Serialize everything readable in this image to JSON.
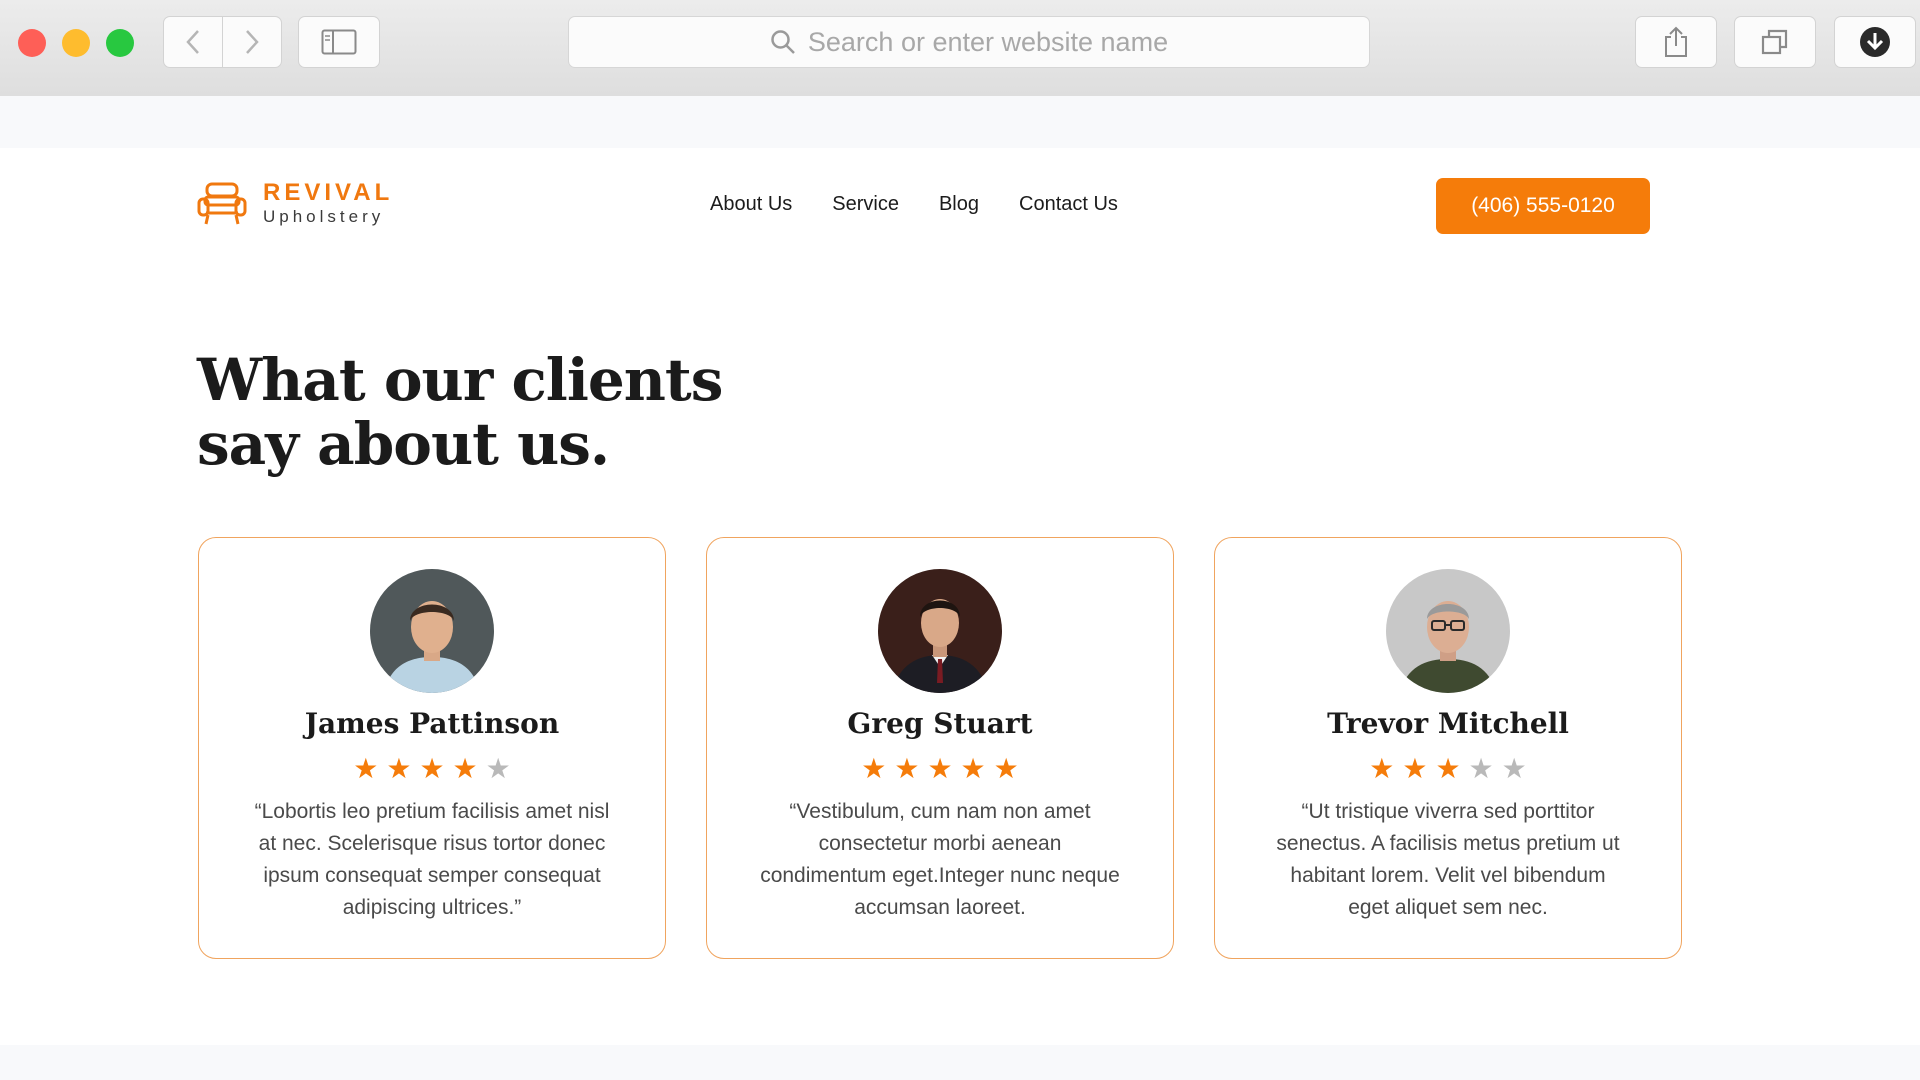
{
  "browser": {
    "address_placeholder": "Search or enter website name"
  },
  "site": {
    "brand": "REVIVAL",
    "tagline": "Upholstery",
    "nav": [
      "About Us",
      "Service",
      "Blog",
      "Contact Us"
    ],
    "phone": "(406) 555-0120",
    "accent_color": "#f57c0a"
  },
  "section": {
    "headline_line1": "What our clients",
    "headline_line2": "say about us."
  },
  "testimonials": [
    {
      "name": "James Pattinson",
      "rating": 4,
      "max_rating": 5,
      "quote": "“Lobortis leo pretium facilisis amet nisl at nec. Scelerisque risus tortor donec ipsum consequat semper consequat adipiscing ultrices.”"
    },
    {
      "name": "Greg Stuart",
      "rating": 5,
      "max_rating": 5,
      "quote": "“Vestibulum, cum nam non amet consectetur morbi aenean condimentum eget.Integer nunc neque accumsan laoreet."
    },
    {
      "name": "Trevor Mitchell",
      "rating": 3,
      "max_rating": 5,
      "quote": "“Ut tristique viverra sed porttitor senectus. A facilisis metus pretium ut habitant lorem. Velit vel bibendum eget aliquet sem nec."
    }
  ]
}
